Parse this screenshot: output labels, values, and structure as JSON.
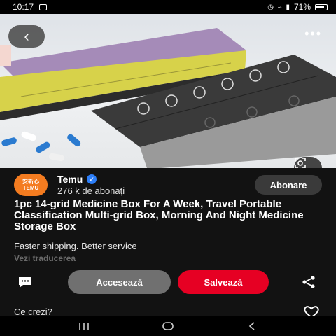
{
  "status_bar": {
    "time": "10:17",
    "battery": "71%"
  },
  "account": {
    "avatar_line1": "安新心",
    "avatar_line2": "TEMU",
    "name": "Temu",
    "followers": "276 k de abonați",
    "follow_label": "Abonare"
  },
  "pin": {
    "title": "1pc 14-grid Medicine Box For A Week, Travel Portable Classification Multi-grid Box, Morning And Night Medicine Storage Box",
    "subtitle": "Faster shipping. Better service",
    "translate_label": "Vezi traducerea"
  },
  "actions": {
    "access_label": "Accesează",
    "save_label": "Salvează"
  },
  "comments": {
    "prompt": "Ce crezi?"
  },
  "colors": {
    "save": "#e60023",
    "access": "#707070",
    "brand": "#f47c20",
    "verified": "#2d7ff9"
  }
}
